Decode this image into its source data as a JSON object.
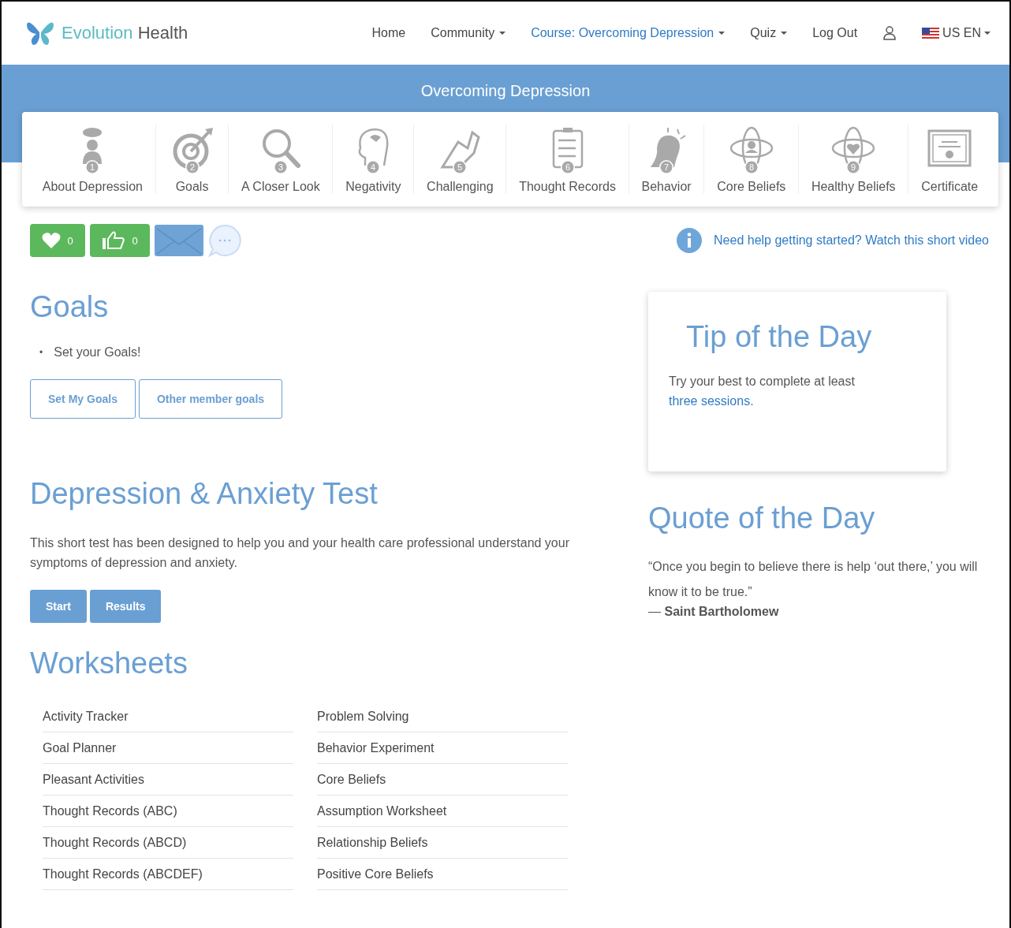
{
  "brand": {
    "name_part1": "Evolution",
    "name_part2": "Health"
  },
  "nav": [
    {
      "label": "Home",
      "dropdown": false,
      "selected": false
    },
    {
      "label": "Community",
      "dropdown": true,
      "selected": false
    },
    {
      "label": "Course: Overcoming Depression",
      "dropdown": true,
      "selected": true
    },
    {
      "label": "Quiz",
      "dropdown": true,
      "selected": false
    },
    {
      "label": "Log Out",
      "dropdown": false,
      "selected": false
    }
  ],
  "language": {
    "label": "US EN"
  },
  "banner": {
    "title": "Overcoming Depression"
  },
  "modules": [
    {
      "label": "About Depression",
      "badge": "1"
    },
    {
      "label": "Goals",
      "badge": "2"
    },
    {
      "label": "A Closer Look",
      "badge": "3"
    },
    {
      "label": "Negativity",
      "badge": "4"
    },
    {
      "label": "Challenging",
      "badge": "5"
    },
    {
      "label": "Thought Records",
      "badge": "6"
    },
    {
      "label": "Behavior",
      "badge": "7"
    },
    {
      "label": "Core Beliefs",
      "badge": "8"
    },
    {
      "label": "Healthy Beliefs",
      "badge": "9"
    },
    {
      "label": "Certificate"
    }
  ],
  "reactions": {
    "likes": "0",
    "thumbs": "0"
  },
  "help_link": "Need help getting started? Watch this short video",
  "goals": {
    "title": "Goals",
    "bullet": "•",
    "items": [
      "Set your Goals!"
    ],
    "buttons": [
      "Set My Goals",
      "Other member goals"
    ]
  },
  "test": {
    "title": "Depression & Anxiety Test",
    "text": "This short test has been designed to help you and your health care professional understand your symptoms of depression and anxiety.",
    "buttons": [
      "Start",
      "Results"
    ]
  },
  "worksheets": {
    "title": "Worksheets",
    "columns": [
      [
        "Activity Tracker",
        "Goal Planner",
        "Pleasant Activities",
        "Thought Records (ABC)",
        "Thought Records (ABCD)",
        "Thought Records (ABCDEF)"
      ],
      [
        "Problem Solving",
        "Behavior Experiment",
        "Core Beliefs",
        "Assumption Worksheet",
        "Relationship Beliefs",
        "Positive Core Beliefs"
      ]
    ]
  },
  "tip": {
    "title": "Tip of the Day",
    "text": "Try your best to complete at least",
    "link": "three sessions."
  },
  "quote": {
    "title": "Quote of the Day",
    "text": "“Once you begin to believe there is help ‘out there,’ you will know it to be true.”",
    "author": "— **Saint Bartholomew**"
  }
}
